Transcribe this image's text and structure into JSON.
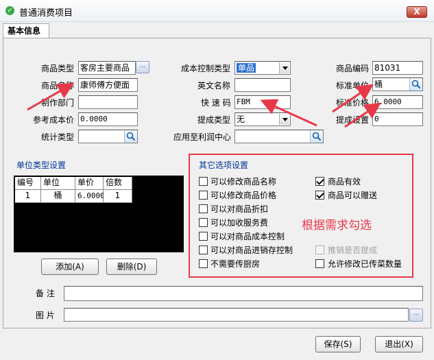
{
  "window": {
    "title": "普通消费项目",
    "close_label": "X"
  },
  "tabs": [
    {
      "label": "基本信息"
    }
  ],
  "form": {
    "product_type": {
      "label": "商品类型",
      "value": "客房主要商品",
      "button": "..."
    },
    "cost_control_type": {
      "label": "成本控制类型",
      "value": "单品"
    },
    "product_code": {
      "label": "商品编码",
      "value": "81031"
    },
    "product_name": {
      "label": "商品名称",
      "value": "康师傅方便面"
    },
    "english_name": {
      "label": "英文名称",
      "value": ""
    },
    "standard_unit": {
      "label": "标准单位",
      "value": "桶"
    },
    "production_dept": {
      "label": "制作部门",
      "value": ""
    },
    "quick_code": {
      "label": "快 速 码",
      "value": "FBM"
    },
    "standard_price": {
      "label": "标准价格",
      "value": "6.0000"
    },
    "reference_cost": {
      "label": "参考成本价",
      "value": "0.0000"
    },
    "commission_type": {
      "label": "提成类型",
      "value": "无"
    },
    "commission_amount": {
      "label": "提成设置",
      "value": "0"
    },
    "stat_type": {
      "label": "统计类型",
      "value": ""
    },
    "profit_center": {
      "label": "应用至利润中心",
      "value": ""
    }
  },
  "unit_settings": {
    "title": "单位类型设置",
    "columns": [
      "编号",
      "单位",
      "单价",
      "倍数"
    ],
    "rows": [
      [
        "1",
        "桶",
        "6.0000",
        "1"
      ]
    ],
    "add_button": "添加(A)",
    "delete_button": "删除(D)"
  },
  "other_options": {
    "title": "其它选项设置",
    "left": [
      {
        "label": "可以修改商品名称",
        "checked": false
      },
      {
        "label": "可以修改商品价格",
        "checked": false
      },
      {
        "label": "可以对商品折扣",
        "checked": false
      },
      {
        "label": "可以加收服务费",
        "checked": false
      },
      {
        "label": "可以对商品成本控制",
        "checked": false
      },
      {
        "label": "可以对商品进销存控制",
        "checked": false
      },
      {
        "label": "不需要传厨房",
        "checked": false
      }
    ],
    "right": [
      {
        "label": "商品有效",
        "checked": true
      },
      {
        "label": "商品可以赠送",
        "checked": true
      },
      {
        "label": "推销是否提成",
        "checked": false,
        "disabled": true
      },
      {
        "label": "允许修改已传菜数量",
        "checked": false
      }
    ]
  },
  "annotation": {
    "text": "根据需求勾选",
    "color": "#e8394a"
  },
  "remarks": {
    "label": "备 注",
    "value": ""
  },
  "picture": {
    "label": "图 片",
    "value": "",
    "button": "..."
  },
  "footer": {
    "save_button": "保存(S)",
    "exit_button": "退出(X)"
  },
  "colors": {
    "accent_red": "#e8394a",
    "group_title_blue": "#003399",
    "grid_black": "#000000"
  }
}
